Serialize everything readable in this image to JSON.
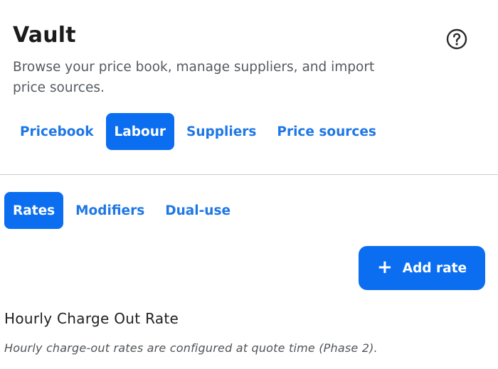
{
  "header": {
    "title": "Vault",
    "subtitle": "Browse your price book, manage suppliers, and import price sources."
  },
  "help": {
    "icon": "help-circle-icon"
  },
  "tabs": [
    {
      "label": "Pricebook",
      "active": false
    },
    {
      "label": "Labour",
      "active": true
    },
    {
      "label": "Suppliers",
      "active": false
    },
    {
      "label": "Price sources",
      "active": false
    }
  ],
  "sub_tabs": [
    {
      "label": "Rates",
      "active": true
    },
    {
      "label": "Modifiers",
      "active": false
    },
    {
      "label": "Dual-use",
      "active": false
    }
  ],
  "actions": {
    "add_rate_label": "Add rate",
    "add_rate_icon": "plus-icon"
  },
  "section": {
    "title": "Hourly Charge Out Rate",
    "note": "Hourly charge-out rates are configured at quote time (Phase 2)."
  },
  "colors": {
    "accent": "#0b6ef0",
    "link": "#1f77e5",
    "text": "#1f1f1f",
    "muted": "#555a60",
    "divider": "#cfcfcf"
  }
}
